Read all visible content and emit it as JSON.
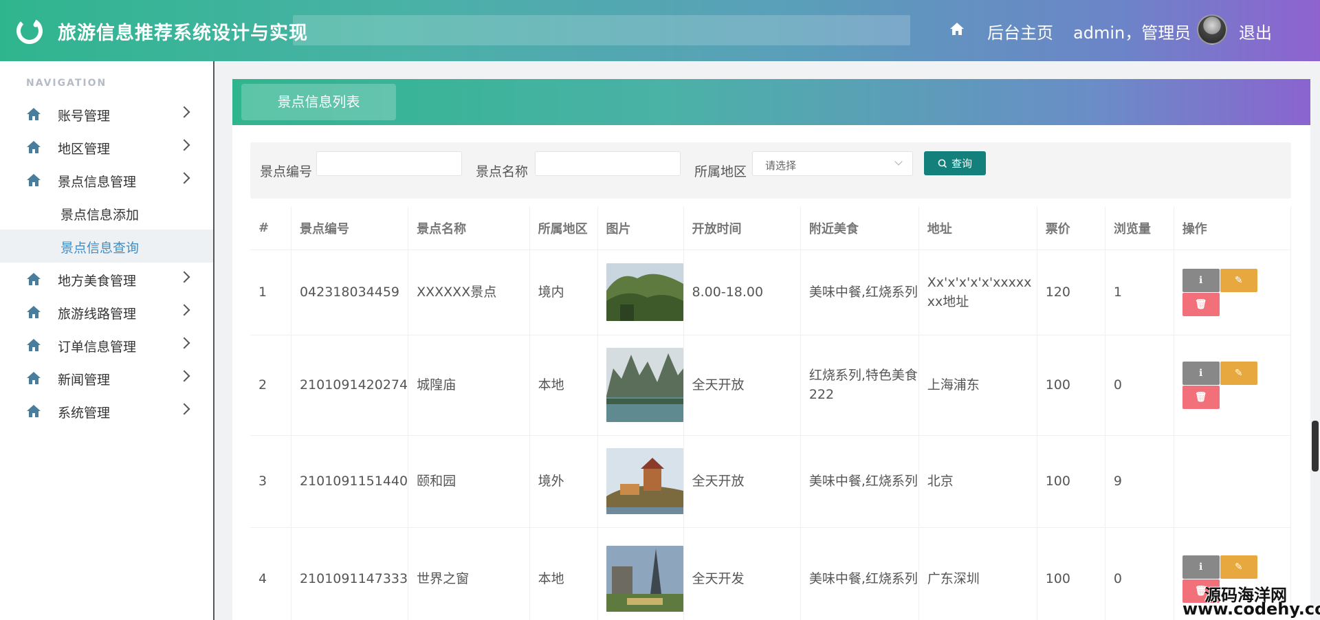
{
  "header": {
    "title": "旅游信息推荐系统设计与实现",
    "home_label": "后台主页",
    "user_label": "admin，管理员",
    "logout_label": "退出",
    "gradient_start": "#2fb58e",
    "gradient_end": "#8e63cf"
  },
  "sidebar": {
    "heading": "NAVIGATION",
    "items": [
      {
        "label": "账号管理",
        "icon": "home-icon"
      },
      {
        "label": "地区管理",
        "icon": "home-icon"
      },
      {
        "label": "景点信息管理",
        "icon": "home-icon",
        "expanded": true
      },
      {
        "label": "地方美食管理",
        "icon": "home-icon"
      },
      {
        "label": "旅游线路管理",
        "icon": "home-icon"
      },
      {
        "label": "订单信息管理",
        "icon": "home-icon"
      },
      {
        "label": "新闻管理",
        "icon": "home-icon"
      },
      {
        "label": "系统管理",
        "icon": "home-icon"
      }
    ],
    "sub_items": [
      {
        "label": "景点信息添加"
      },
      {
        "label": "景点信息查询",
        "active": true
      }
    ],
    "active_color": "#3f8dc5"
  },
  "panel": {
    "tab_label": "景点信息列表"
  },
  "search": {
    "code_label": "景点编号",
    "code_value": "",
    "name_label": "景点名称",
    "name_value": "",
    "region_label": "所属地区",
    "region_selected": "请选择",
    "query_label": "查询",
    "query_color": "#13807b"
  },
  "table": {
    "headers": [
      "#",
      "景点编号",
      "景点名称",
      "所属地区",
      "图片",
      "开放时间",
      "附近美食",
      "地址",
      "票价",
      "浏览量",
      "操作"
    ],
    "rows": [
      {
        "idx": "1",
        "code": "042318034459",
        "name": "XXXXXX景点",
        "region": "境内",
        "image": "mountain-forest-photo",
        "hours": "8.00-18.00",
        "food": "美味中餐,红烧系列",
        "address": "Xx'x'x'x'x'xxxxxxx地址",
        "price": "120",
        "views": "1"
      },
      {
        "idx": "2",
        "code": "2101091420274",
        "name": "城隍庙",
        "region": "本地",
        "image": "karst-lake-photo",
        "hours": "全天开放",
        "food": "红烧系列,特色美食222",
        "address": "上海浦东",
        "price": "100",
        "views": "0"
      },
      {
        "idx": "3",
        "code": "2101091151440",
        "name": "颐和园",
        "region": "境外",
        "image": "summer-palace-photo",
        "hours": "全天开放",
        "food": "美味中餐,红烧系列",
        "address": "北京",
        "price": "100",
        "views": "9"
      },
      {
        "idx": "4",
        "code": "2101091147333",
        "name": "世界之窗",
        "region": "本地",
        "image": "window-of-world-photo",
        "hours": "全天开发",
        "food": "美味中餐,红烧系列",
        "address": "广东深圳",
        "price": "100",
        "views": "0"
      }
    ],
    "ops": {
      "info_icon": "info-icon",
      "edit_icon": "edit-icon",
      "delete_icon": "trash-icon",
      "info_color": "#888888",
      "edit_color": "#e7a83f",
      "delete_color": "#f2707a"
    }
  },
  "watermark": {
    "line1": "源码海洋网",
    "line2": "www.codehy.com"
  }
}
